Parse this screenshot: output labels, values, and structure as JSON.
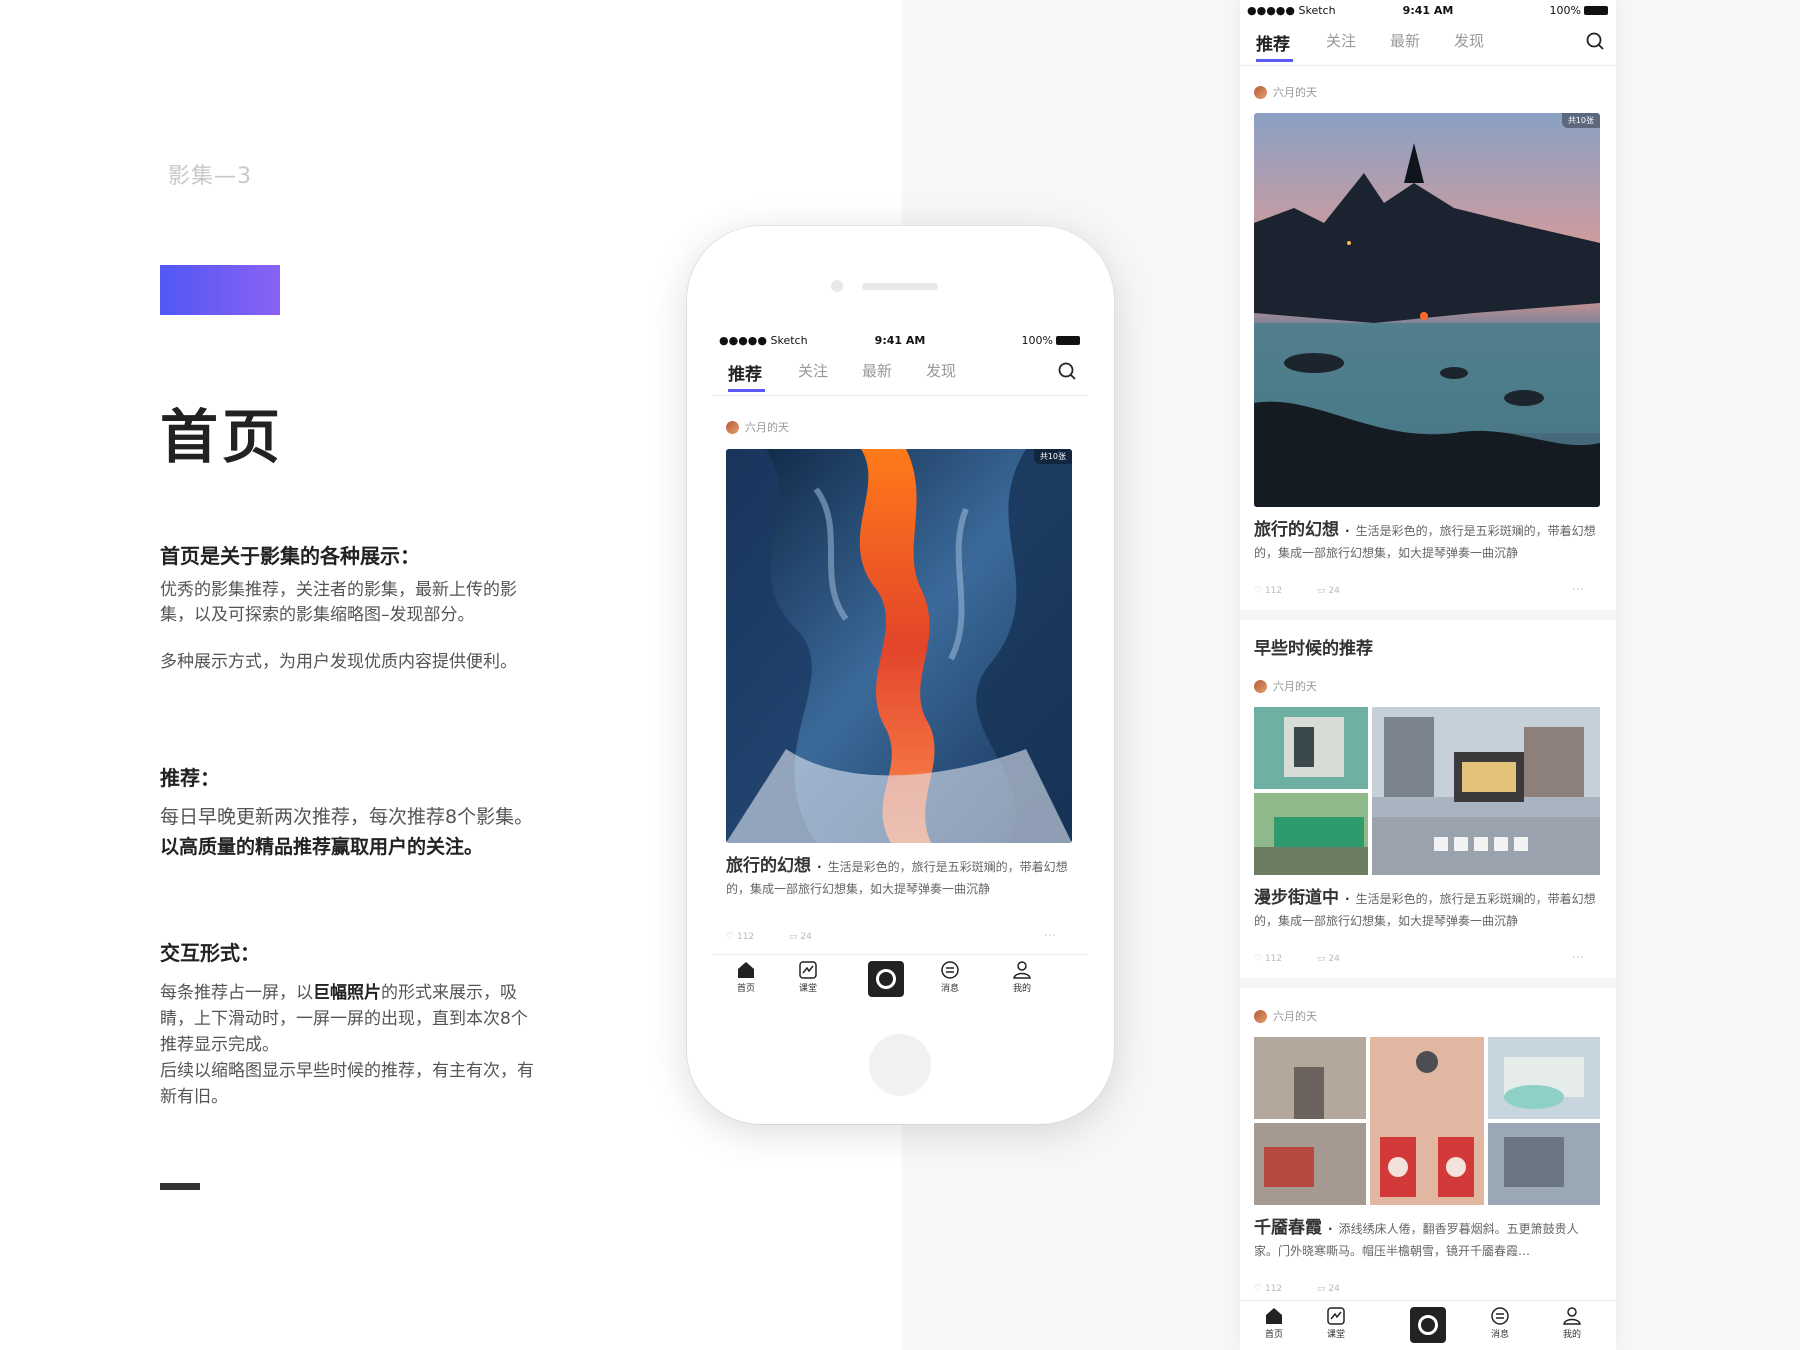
{
  "left": {
    "subtitle": "影集—3",
    "title": "首页",
    "heading1": "首页是关于影集的各种展示：",
    "para1": "优秀的影集推荐，关注者的影集，最新上传的影集，以及可探索的影集缩略图–发现部分。",
    "para2": "多种展示方式，为用户发现优质内容提供便利。",
    "heading2": "推荐：",
    "para3_a": "每日早晚更新两次推荐，每次推荐8个影集。",
    "para3_b": "以高质量的精品推荐赢取用户的关注。",
    "heading3": "交互形式：",
    "para4_a": "每条推荐占一屏，以",
    "para4_b": "巨幅照片",
    "para4_c": "的形式来展示，吸睛，上下滑动时，一屏一屏的出现，直到本次8个推荐显示完成。",
    "para5": "后续以缩略图显示早些时候的推荐，有主有次，有新有旧。"
  },
  "status": {
    "carrier": "●●●●● Sketch",
    "time": "9:41 AM",
    "battery": "100%"
  },
  "tabs": [
    "推荐",
    "关注",
    "最新",
    "发现"
  ],
  "author": "六月的天",
  "badge": "共10张",
  "post1": {
    "title": "旅行的幻想",
    "desc": "生活是彩色的，旅行是五彩斑斓的，带着幻想的，集成一部旅行幻想集，如大提琴弹奏一曲沉静",
    "likes": "112",
    "comments": "24",
    "more": "···"
  },
  "section_title": "早些时候的推荐",
  "post2": {
    "title": "漫步街道中",
    "desc": "生活是彩色的，旅行是五彩斑斓的，带着幻想的，集成一部旅行幻想集，如大提琴弹奏一曲沉静",
    "likes": "112",
    "comments": "24",
    "more": "···"
  },
  "post3": {
    "title": "千靥春霞",
    "desc": "添线绣床人倦，翻香罗暮烟斜。五更箫鼓贵人家。门外晓寒嘶马。帽压半檐朝雪，镜开千靥春霞…",
    "likes": "112",
    "comments": "24",
    "more": "···"
  },
  "nav": [
    "首页",
    "课堂",
    "消息",
    "我的"
  ],
  "colors": {
    "accent": "#5a5cf5",
    "gradient_start": "#5157f5",
    "gradient_end": "#8a62f3"
  }
}
